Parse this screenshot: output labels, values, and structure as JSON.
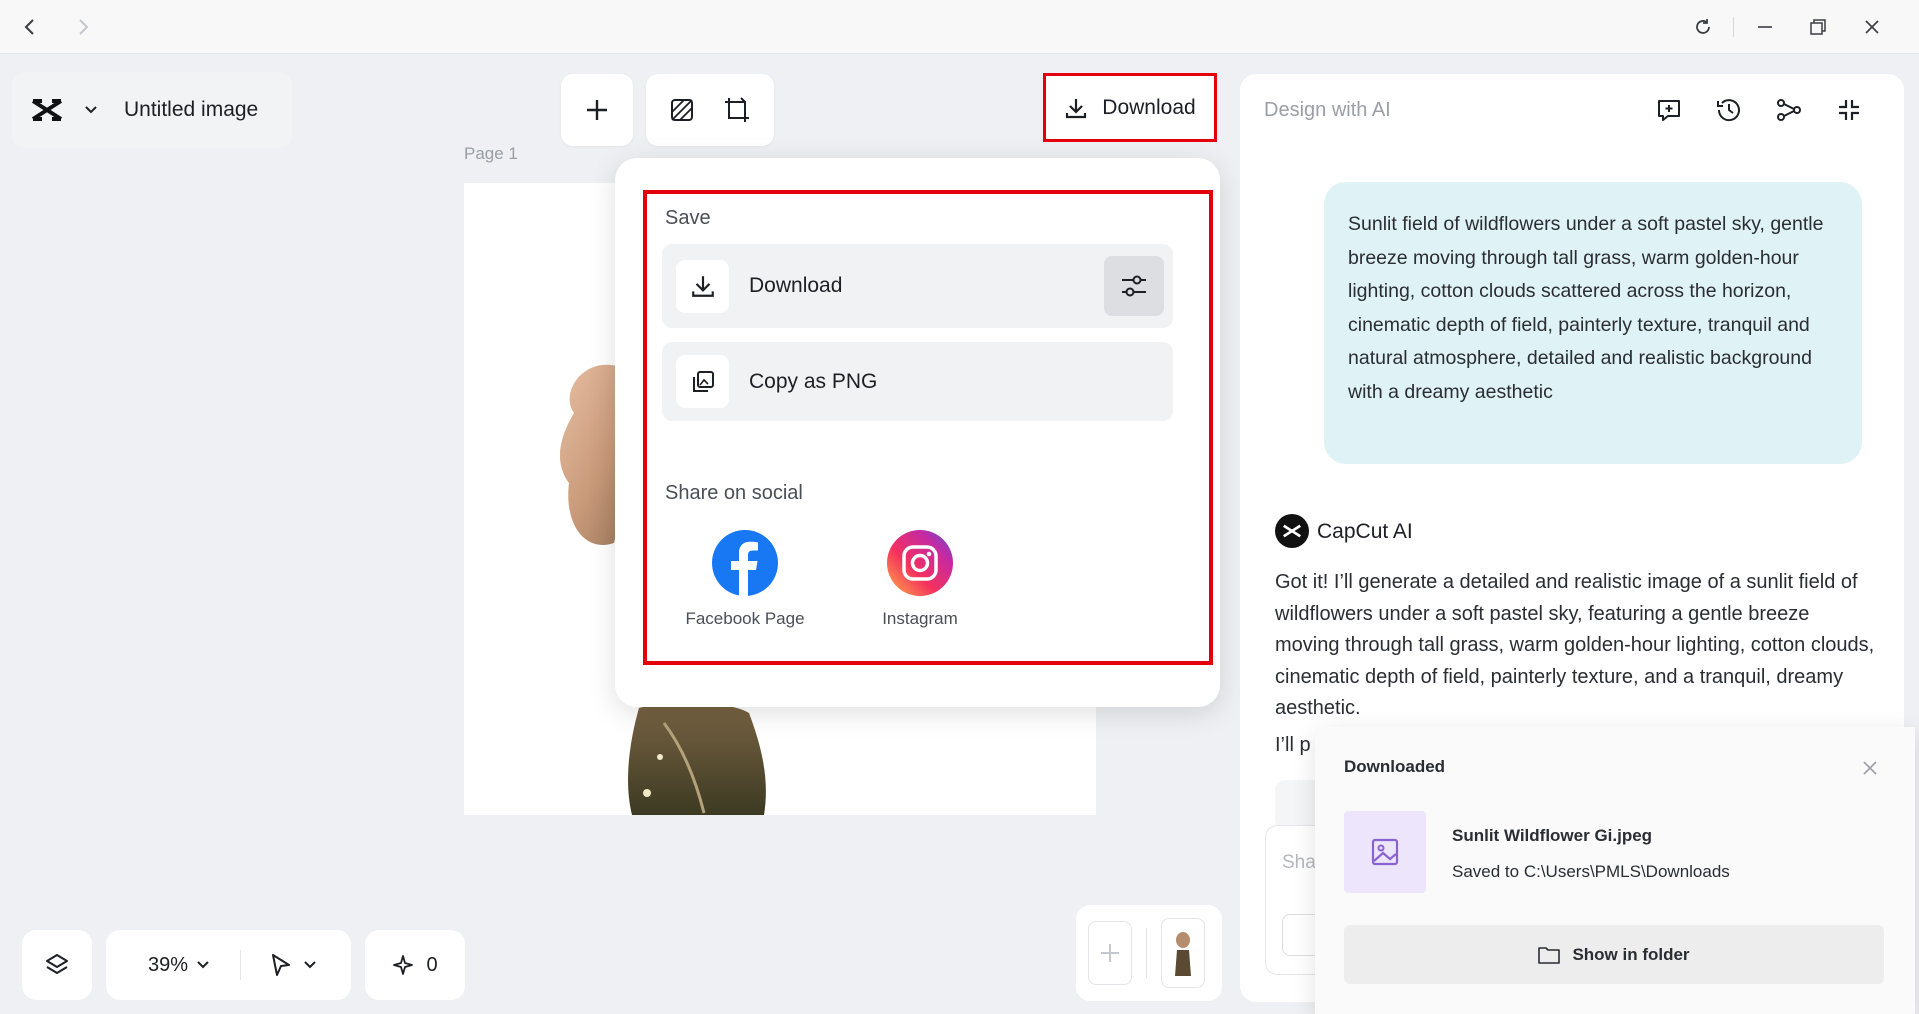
{
  "app": {
    "title": "Untitled image"
  },
  "canvas": {
    "page_label": "Page 1"
  },
  "header": {
    "download_label": "Download"
  },
  "dropdown": {
    "save_section": "Save",
    "download_option": "Download",
    "copy_option": "Copy as PNG",
    "share_section": "Share on social",
    "facebook_label": "Facebook Page",
    "instagram_label": "Instagram"
  },
  "ai_panel": {
    "title": "Design with AI",
    "user_prompt": "Sunlit field of wildflowers under a soft pastel sky, gentle breeze moving through tall grass, warm golden-hour lighting, cotton clouds scattered across the horizon, cinematic depth of field, painterly texture, tranquil and natural atmosphere, detailed and realistic background with a dreamy aesthetic",
    "ai_name": "CapCut AI",
    "ai_response": "Got it! I’ll generate a detailed and realistic image of a sunlit field of wildflowers under a soft pastel sky, featuring a gentle breeze moving through tall grass, warm golden-hour lighting, cotton clouds, cinematic depth of field, painterly texture, and a tranquil, dreamy aesthetic.",
    "ai_response_truncated": "I’ll p",
    "input_placeholder_partial": "Sha"
  },
  "download_popup": {
    "heading": "Downloaded",
    "file_name": "Sunlit Wildflower Gi.jpeg",
    "saved_path": "Saved to C:\\Users\\PMLS\\Downloads",
    "show_folder": "Show in folder"
  },
  "bottom_bar": {
    "zoom": "39%",
    "credits": "0"
  },
  "colors": {
    "highlight": "#e4000b",
    "facebook": "#1877f2",
    "user_bubble": "#dff3f7",
    "file_thumb": "#ece5fb"
  }
}
